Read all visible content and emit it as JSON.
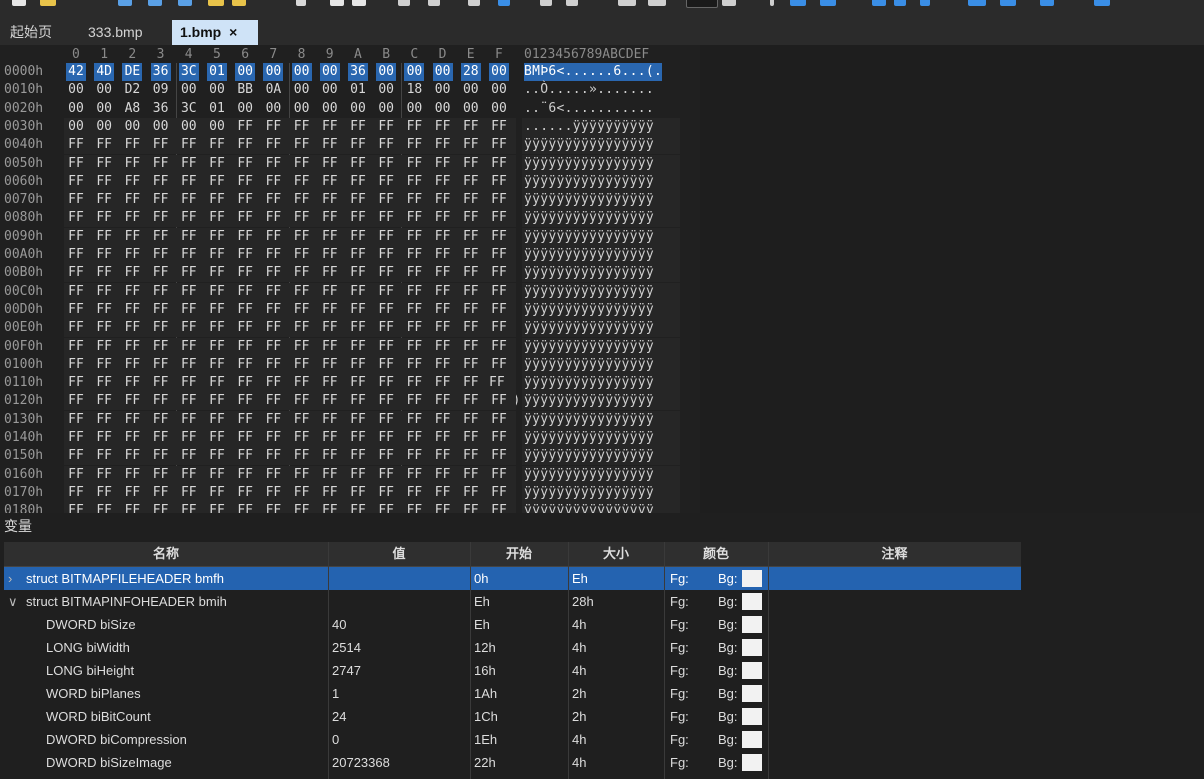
{
  "tabs": [
    {
      "label": "起始页"
    },
    {
      "label": "333.bmp"
    },
    {
      "label": "1.bmp",
      "close": "×"
    }
  ],
  "hex": {
    "col_headers": [
      "0",
      "1",
      "2",
      "3",
      "4",
      "5",
      "6",
      "7",
      "8",
      "9",
      "A",
      "B",
      "C",
      "D",
      "E",
      "F"
    ],
    "ascii_header": "0123456789ABCDEF",
    "rows": [
      {
        "addr": "0000h",
        "bytes": [
          "42",
          "4D",
          "DE",
          "36",
          "3C",
          "01",
          "00",
          "00",
          "00",
          "00",
          "36",
          "00",
          "00",
          "00",
          "28",
          "00"
        ],
        "ascii": "BMÞ6<......6...(."
      },
      {
        "addr": "0010h",
        "bytes": [
          "00",
          "00",
          "D2",
          "09",
          "00",
          "00",
          "BB",
          "0A",
          "00",
          "00",
          "01",
          "00",
          "18",
          "00",
          "00",
          "00"
        ],
        "ascii": "..Ò.....»......."
      },
      {
        "addr": "0020h",
        "bytes": [
          "00",
          "00",
          "A8",
          "36",
          "3C",
          "01",
          "00",
          "00",
          "00",
          "00",
          "00",
          "00",
          "00",
          "00",
          "00",
          "00"
        ],
        "ascii": "..¨6<..........."
      },
      {
        "addr": "0030h",
        "bytes": [
          "00",
          "00",
          "00",
          "00",
          "00",
          "00",
          "FF",
          "FF",
          "FF",
          "FF",
          "FF",
          "FF",
          "FF",
          "FF",
          "FF",
          "FF"
        ],
        "ascii": "......ÿÿÿÿÿÿÿÿÿÿ"
      },
      {
        "addr": "0040h",
        "ff": true
      },
      {
        "addr": "0050h",
        "ff": true
      },
      {
        "addr": "0060h",
        "ff": true
      },
      {
        "addr": "0070h",
        "ff": true
      },
      {
        "addr": "0080h",
        "ff": true
      },
      {
        "addr": "0090h",
        "ff": true
      },
      {
        "addr": "00A0h",
        "ff": true
      },
      {
        "addr": "00B0h",
        "ff": true
      },
      {
        "addr": "00C0h",
        "ff": true
      },
      {
        "addr": "00D0h",
        "ff": true
      },
      {
        "addr": "00E0h",
        "ff": true
      },
      {
        "addr": "00F0h",
        "ff": true
      },
      {
        "addr": "0100h",
        "ff": true
      },
      {
        "addr": "0110h",
        "ff": true,
        "last": "FF (FF)"
      },
      {
        "addr": "0120h",
        "ff": true
      },
      {
        "addr": "0130h",
        "ff": true
      },
      {
        "addr": "0140h",
        "ff": true
      },
      {
        "addr": "0150h",
        "ff": true
      },
      {
        "addr": "0160h",
        "ff": true
      },
      {
        "addr": "0170h",
        "ff": true
      },
      {
        "addr": "0180h",
        "ff": true
      }
    ],
    "ff_byte": "FF",
    "ff_ascii": "ÿÿÿÿÿÿÿÿÿÿÿÿÿÿÿÿ"
  },
  "variables": {
    "title": "变量",
    "headers": {
      "name": "名称",
      "value": "值",
      "start": "开始",
      "size": "大小",
      "color": "颜色",
      "comment": "注释"
    },
    "rows": [
      {
        "expander": "›",
        "name": "struct BITMAPFILEHEADER bmfh",
        "value": "",
        "start": "0h",
        "size": "Eh",
        "fg": "Fg:",
        "bg": "Bg:",
        "selected": true,
        "indent": 0
      },
      {
        "expander": "∨",
        "name": "struct BITMAPINFOHEADER bmih",
        "value": "",
        "start": "Eh",
        "size": "28h",
        "fg": "Fg:",
        "bg": "Bg:",
        "indent": 0
      },
      {
        "expander": "",
        "name": "DWORD biSize",
        "value": "40",
        "start": "Eh",
        "size": "4h",
        "fg": "Fg:",
        "bg": "Bg:",
        "indent": 1
      },
      {
        "expander": "",
        "name": "LONG biWidth",
        "value": "2514",
        "start": "12h",
        "size": "4h",
        "fg": "Fg:",
        "bg": "Bg:",
        "indent": 1
      },
      {
        "expander": "",
        "name": "LONG biHeight",
        "value": "2747",
        "start": "16h",
        "size": "4h",
        "fg": "Fg:",
        "bg": "Bg:",
        "indent": 1
      },
      {
        "expander": "",
        "name": "WORD biPlanes",
        "value": "1",
        "start": "1Ah",
        "size": "2h",
        "fg": "Fg:",
        "bg": "Bg:",
        "indent": 1
      },
      {
        "expander": "",
        "name": "WORD biBitCount",
        "value": "24",
        "start": "1Ch",
        "size": "2h",
        "fg": "Fg:",
        "bg": "Bg:",
        "indent": 1
      },
      {
        "expander": "",
        "name": "DWORD biCompression",
        "value": "0",
        "start": "1Eh",
        "size": "4h",
        "fg": "Fg:",
        "bg": "Bg:",
        "indent": 1
      },
      {
        "expander": "",
        "name": "DWORD biSizeImage",
        "value": "20723368",
        "start": "22h",
        "size": "4h",
        "fg": "Fg:",
        "bg": "Bg:",
        "indent": 1
      }
    ]
  },
  "colors": {
    "selection": "#2a67b0",
    "row_selected": "#2463b0",
    "tab_active": "#cfe3f7",
    "toolbar_accent": "#3a8ee6"
  }
}
